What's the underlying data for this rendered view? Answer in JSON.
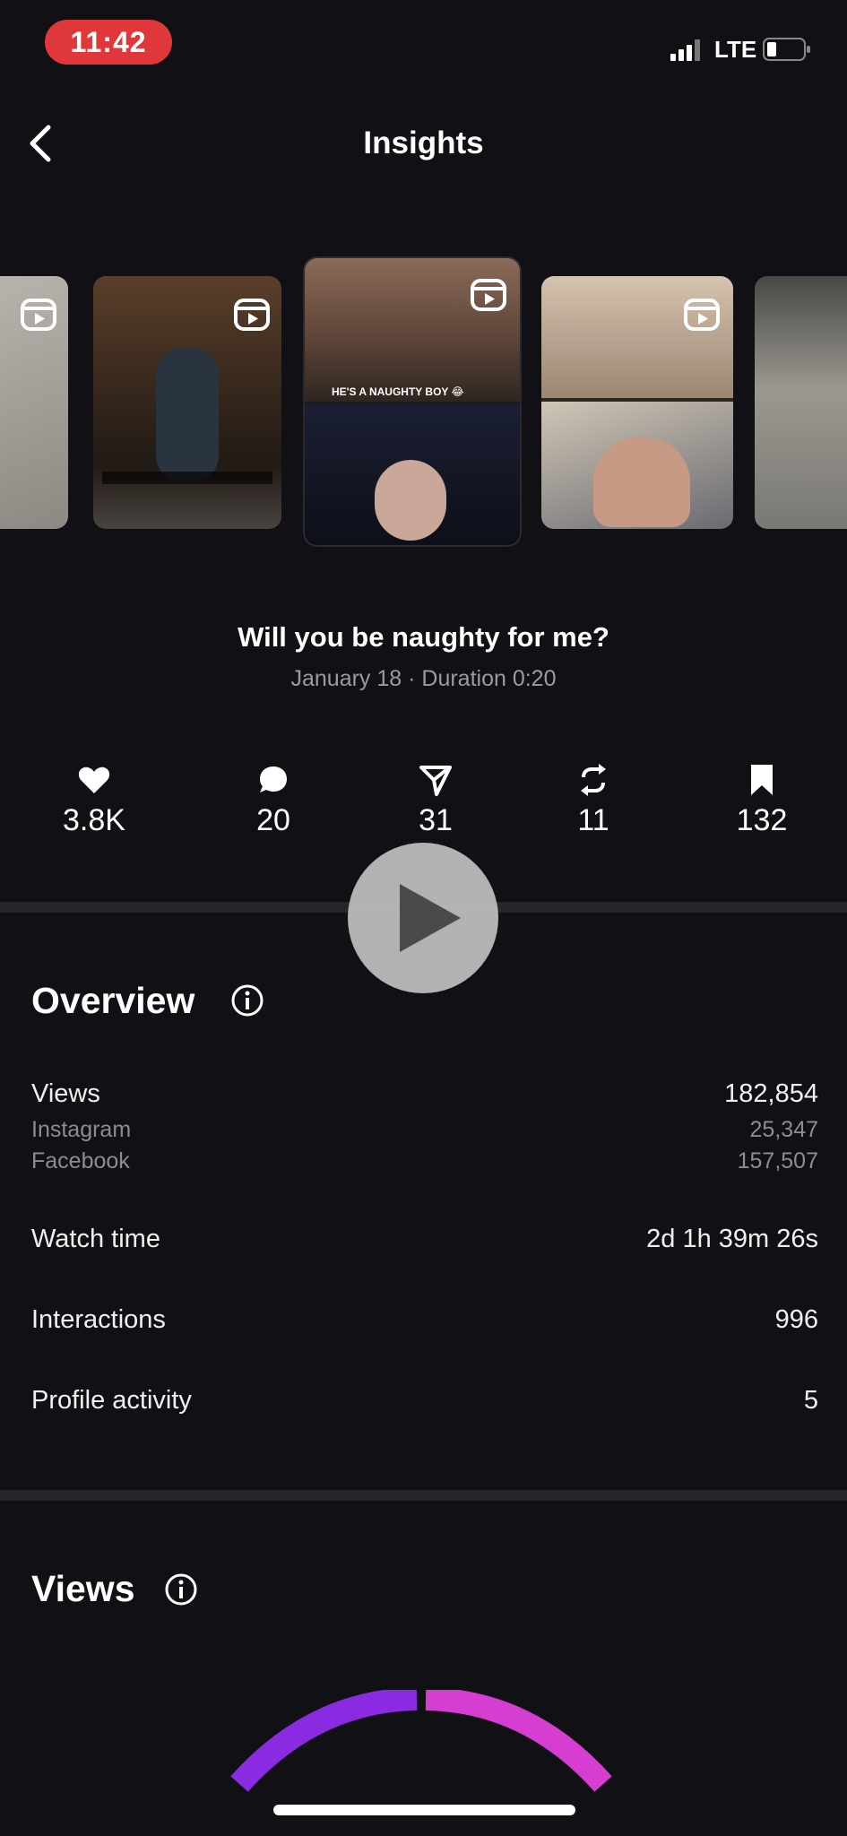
{
  "status_bar": {
    "time": "11:42",
    "network": "LTE"
  },
  "header": {
    "title": "Insights"
  },
  "post": {
    "title": "Will you be naughty for me?",
    "subtitle": "January 18 · Duration 0:20",
    "thumbnail_caption": "HE'S A NAUGHTY BOY 😂"
  },
  "stats": [
    {
      "icon": "heart-icon",
      "value": "3.8K"
    },
    {
      "icon": "comment-icon",
      "value": "20"
    },
    {
      "icon": "share-icon",
      "value": "31"
    },
    {
      "icon": "repost-icon",
      "value": "11"
    },
    {
      "icon": "bookmark-icon",
      "value": "132"
    }
  ],
  "overview": {
    "title": "Overview",
    "views_label": "Views",
    "views_value": "182,854",
    "instagram_label": "Instagram",
    "instagram_value": "25,347",
    "facebook_label": "Facebook",
    "facebook_value": "157,507",
    "watch_time_label": "Watch time",
    "watch_time_value": "2d 1h 39m 26s",
    "interactions_label": "Interactions",
    "interactions_value": "996",
    "profile_activity_label": "Profile activity",
    "profile_activity_value": "5"
  },
  "views_section": {
    "title": "Views"
  },
  "colors": {
    "background": "#111115",
    "status_pill": "#e0373b",
    "gauge_left": "#8a2be2",
    "gauge_right": "#d63ed1",
    "muted_text": "#8c8c94"
  }
}
